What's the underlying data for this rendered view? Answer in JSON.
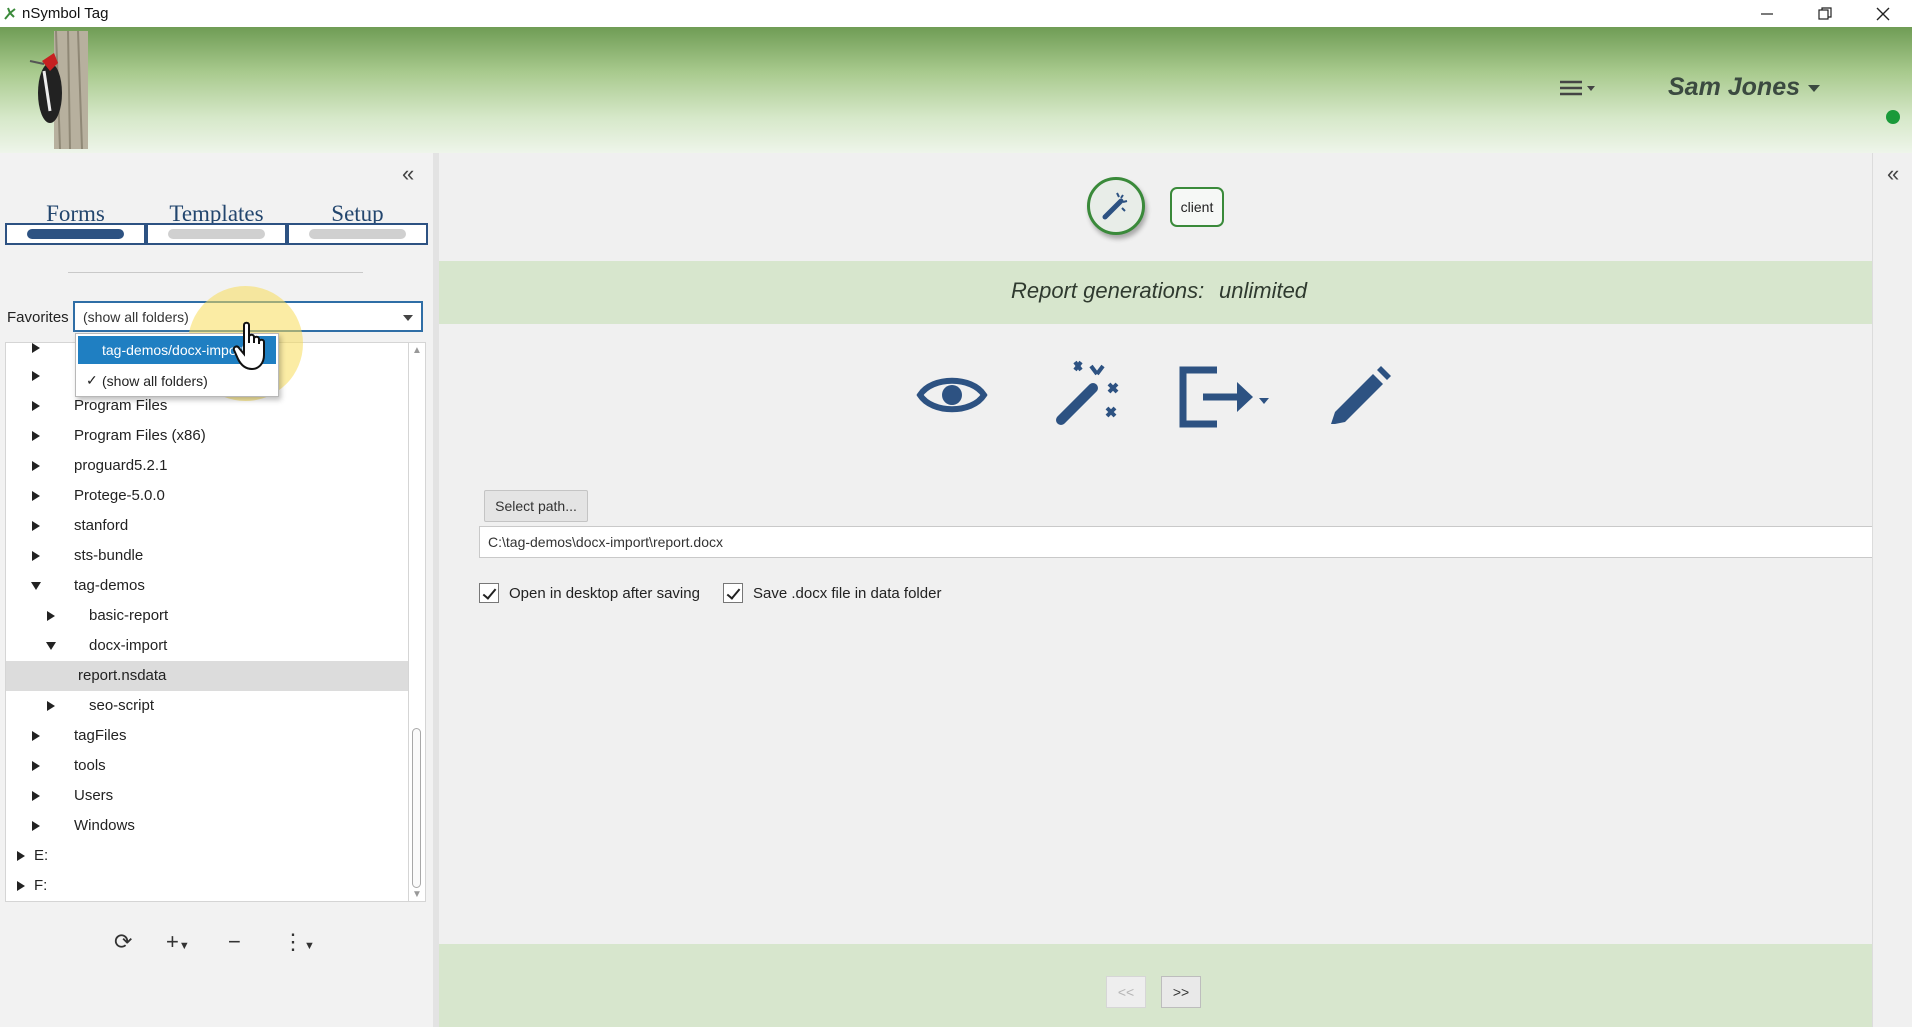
{
  "window": {
    "title": "nSymbol Tag",
    "minimize": "—",
    "maximize": "❐",
    "close": "✕"
  },
  "header": {
    "user_name": "Sam Jones",
    "menu_icon": "hamburger-dropdown-icon",
    "status_color": "#1a9a3a"
  },
  "left_panel": {
    "collapse_glyph": "«",
    "tabs": [
      {
        "label": "Forms",
        "active": true
      },
      {
        "label": "Templates",
        "active": false
      },
      {
        "label": "Setup",
        "active": false
      }
    ],
    "favorites_label": "Favorites",
    "favorites_value": "(show all folders)",
    "favorites_options": [
      {
        "label": "tag-demos/docx-import",
        "highlighted": true,
        "checked": false
      },
      {
        "label": "(show all folders)",
        "highlighted": false,
        "checked": true
      }
    ],
    "tree": [
      {
        "label": "Program Files",
        "expanded": false,
        "selected": false
      },
      {
        "label": "Program Files (x86)",
        "expanded": false,
        "selected": false
      },
      {
        "label": "proguard5.2.1",
        "expanded": false,
        "selected": false
      },
      {
        "label": "Protege-5.0.0",
        "expanded": false,
        "selected": false
      },
      {
        "label": "stanford",
        "expanded": false,
        "selected": false
      },
      {
        "label": "sts-bundle",
        "expanded": false,
        "selected": false
      },
      {
        "label": "tag-demos",
        "expanded": true,
        "selected": false
      },
      {
        "label": "basic-report",
        "expanded": false,
        "selected": false
      },
      {
        "label": "docx-import",
        "expanded": true,
        "selected": false
      },
      {
        "label": "report.nsdata",
        "expanded": null,
        "selected": true
      },
      {
        "label": "seo-script",
        "expanded": false,
        "selected": false
      },
      {
        "label": "tagFiles",
        "expanded": false,
        "selected": false
      },
      {
        "label": "tools",
        "expanded": false,
        "selected": false
      },
      {
        "label": "Users",
        "expanded": false,
        "selected": false
      },
      {
        "label": "Windows",
        "expanded": false,
        "selected": false
      },
      {
        "label": "E:",
        "expanded": false,
        "selected": false
      },
      {
        "label": "F:",
        "expanded": false,
        "selected": false
      }
    ],
    "tools": {
      "refresh": "⟳",
      "add": "+",
      "remove": "−",
      "more": "⋮"
    }
  },
  "main": {
    "client_label": "client",
    "report_label": "Report generations:",
    "report_value": "unlimited",
    "action_icons": [
      "preview-eye-icon",
      "magic-wand-icon",
      "export-icon",
      "edit-pencil-icon"
    ],
    "select_path_label": "Select path...",
    "path_value": "C:\\tag-demos\\docx-import\\report.docx",
    "checkbox_open": "Open in desktop after saving",
    "checkbox_save": "Save .docx file in data folder",
    "prev_label": "<<",
    "next_label": ">>",
    "accent": "#2d5282",
    "green": "#3a8a3a"
  },
  "right_strip": {
    "collapse_glyph": "«"
  }
}
